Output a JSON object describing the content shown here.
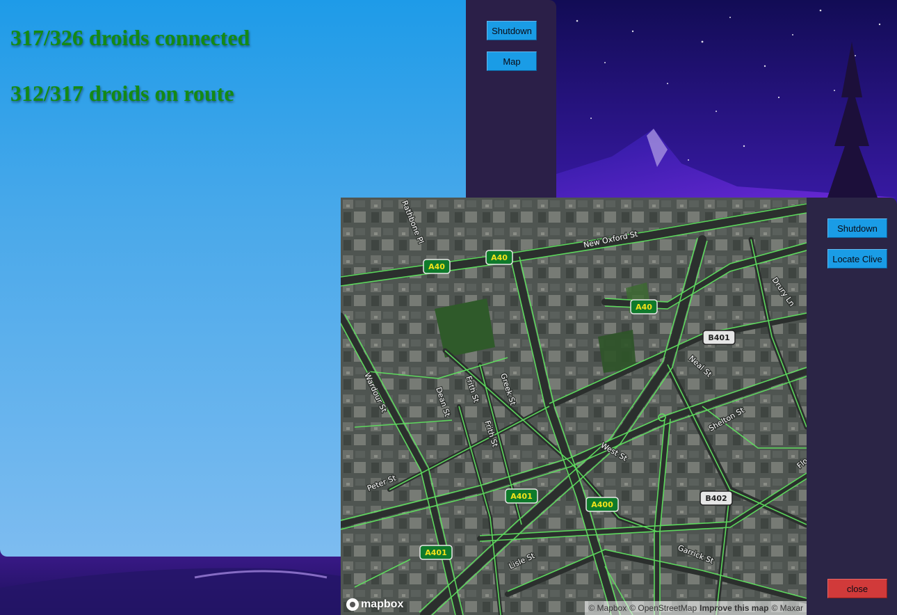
{
  "status": {
    "connected_text": "317/326 droids connected",
    "on_route_text": "312/317 droids on route",
    "text_color": "#148a14"
  },
  "main_sidebar": {
    "shutdown_label": "Shutdown",
    "map_label": "Map"
  },
  "map_sidebar": {
    "shutdown_label": "Shutdown",
    "locate_label": "Locate Clive",
    "close_label": "close"
  },
  "map": {
    "logo_text": "mapbox",
    "attribution": {
      "mapbox": "© Mapbox",
      "osm": "© OpenStreetMap",
      "improve": "Improve this map",
      "maxar": "© Maxar"
    },
    "road_shields": [
      {
        "ref": "A40",
        "kind": "primary"
      },
      {
        "ref": "A40",
        "kind": "primary"
      },
      {
        "ref": "A40",
        "kind": "primary"
      },
      {
        "ref": "B401",
        "kind": "secondary"
      },
      {
        "ref": "A401",
        "kind": "primary"
      },
      {
        "ref": "A400",
        "kind": "primary"
      },
      {
        "ref": "B402",
        "kind": "secondary"
      },
      {
        "ref": "A401",
        "kind": "primary"
      }
    ],
    "street_labels": [
      {
        "name": "New Oxford St"
      },
      {
        "name": "Rathbone Pl"
      },
      {
        "name": "Drury Ln"
      },
      {
        "name": "Neal St"
      },
      {
        "name": "Wardour St"
      },
      {
        "name": "Frith St"
      },
      {
        "name": "Greek St"
      },
      {
        "name": "Dean St"
      },
      {
        "name": "Frith St"
      },
      {
        "name": "Shelton St"
      },
      {
        "name": "West St"
      },
      {
        "name": "Peter St"
      },
      {
        "name": "Lisle St"
      },
      {
        "name": "Garrick St"
      },
      {
        "name": "Flo"
      }
    ],
    "route_color": "#5fe05f",
    "road_color": "#2b2f2d"
  },
  "colors": {
    "button_blue": "#1a9ce6",
    "close_red": "#d13a3a",
    "sidebar_bg": "#2b1f48"
  }
}
